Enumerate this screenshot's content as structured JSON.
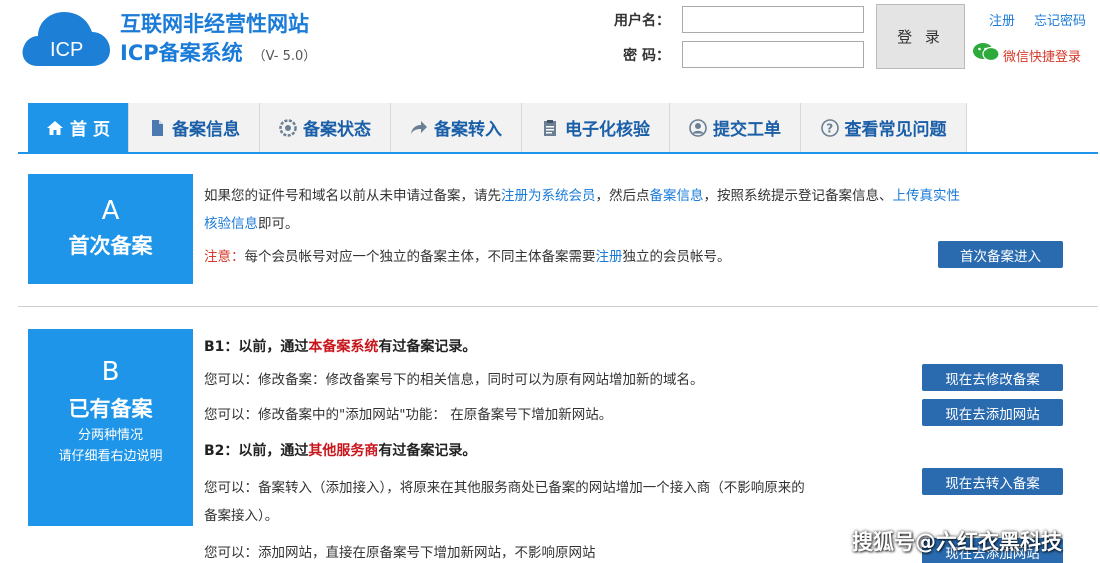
{
  "header": {
    "logo_badge": "ICP",
    "title_line1": "互联网非经营性网站",
    "title_line2": "ICP备案系统",
    "version": "（V- 5.0）"
  },
  "login": {
    "username_label": "用户名：",
    "password_label": "密 码：",
    "username_value": "",
    "password_value": "",
    "login_button": "登 录",
    "register_link": "注册",
    "forgot_link": "忘记密码",
    "wechat_login": "微信快捷登录"
  },
  "nav": {
    "items": [
      {
        "label": "首 页",
        "icon": "home-icon"
      },
      {
        "label": "备案信息",
        "icon": "document-icon"
      },
      {
        "label": "备案状态",
        "icon": "status-icon"
      },
      {
        "label": "备案转入",
        "icon": "transfer-arrow-icon"
      },
      {
        "label": "电子化核验",
        "icon": "clipboard-icon"
      },
      {
        "label": "提交工单",
        "icon": "user-icon"
      },
      {
        "label": "查看常见问题",
        "icon": "question-icon"
      }
    ]
  },
  "section_a": {
    "letter": "A",
    "title": "首次备案",
    "para1_a": "如果您的证件号和域名以前从未申请过备案，请先",
    "para1_link1": "注册为系统会员",
    "para1_b": "，然后点",
    "para1_link2": "备案信息",
    "para1_c": "，按照系统提示登记备案信息、",
    "para1_link3": "上传真实性",
    "para1_link3b": "核验信息",
    "para1_d": "即可。",
    "note_label": "注意：",
    "note_a": "每个会员帐号对应一个独立的备案主体，不同主体备案需要",
    "note_link": "注册",
    "note_b": "独立的会员帐号。",
    "button": "首次备案进入"
  },
  "section_b": {
    "letter": "B",
    "title": "已有备案",
    "sub1": "分两种情况",
    "sub2": "请仔细看右边说明",
    "b1_a": "B1：以前，通过",
    "b1_red": "本备案系统",
    "b1_b": "有过备案记录。",
    "b1_line1": "您可以：修改备案：修改备案号下的相关信息，同时可以为原有网站增加新的域名。",
    "b1_line2": "您可以：修改备案中的\"添加网站\"功能： 在原备案号下增加新网站。",
    "b1_btn1": "现在去修改备案",
    "b1_btn2": "现在去添加网站",
    "b2_a": "B2：以前，通过",
    "b2_red": "其他服务商",
    "b2_b": "有过备案记录。",
    "b2_line1": "您可以：备案转入（添加接入），将原来在其他服务商处已备案的网站增加一个接入商（不影响原来的",
    "b2_line1b": "备案接入）。",
    "b2_line2": "您可以：添加网站，直接在原备案号下增加新网站，不影响原网站",
    "b2_btn1": "现在去转入备案",
    "b2_btn2": "现在去添加网站"
  },
  "watermark": "搜狐号@六红衣黑科技",
  "colors": {
    "primary_blue": "#1e95e8",
    "button_blue": "#2a6bb0",
    "link_blue": "#1a7bd8",
    "alert_red": "#d63a2a"
  }
}
